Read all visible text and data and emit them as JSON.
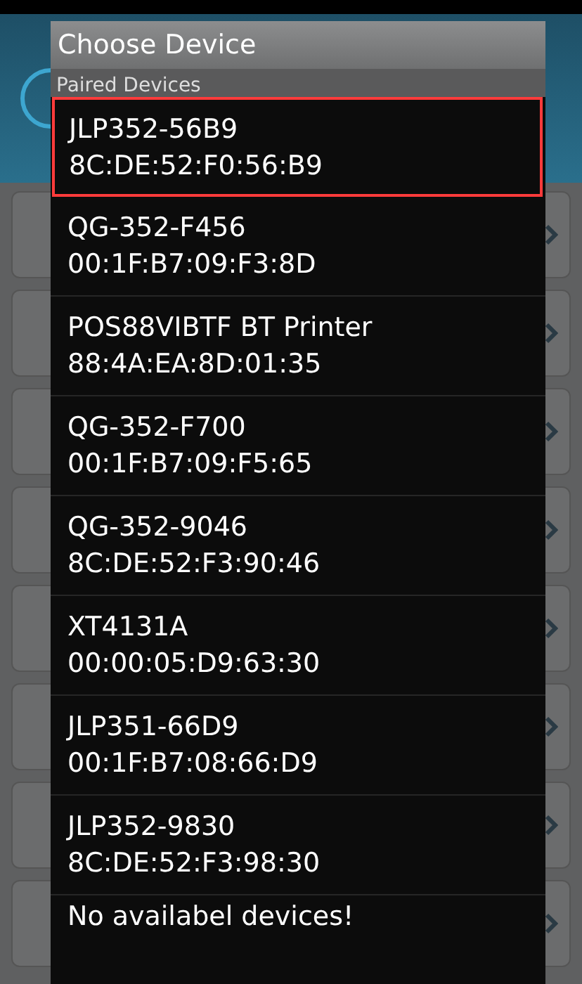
{
  "dialog": {
    "title": "Choose Device",
    "section": "Paired Devices",
    "devices": [
      {
        "name": "JLP352-56B9",
        "address": "8C:DE:52:F0:56:B9",
        "selected": true
      },
      {
        "name": "QG-352-F456",
        "address": "00:1F:B7:09:F3:8D",
        "selected": false
      },
      {
        "name": "POS88VIBTF BT Printer",
        "address": "88:4A:EA:8D:01:35",
        "selected": false
      },
      {
        "name": "QG-352-F700",
        "address": "00:1F:B7:09:F5:65",
        "selected": false
      },
      {
        "name": "QG-352-9046",
        "address": "8C:DE:52:F3:90:46",
        "selected": false
      },
      {
        "name": "XT4131A",
        "address": "00:00:05:D9:63:30",
        "selected": false
      },
      {
        "name": "JLP351-66D9",
        "address": "00:1F:B7:08:66:D9",
        "selected": false
      },
      {
        "name": "JLP352-9830",
        "address": "8C:DE:52:F3:98:30",
        "selected": false
      }
    ],
    "footer": "No availabel devices!"
  }
}
